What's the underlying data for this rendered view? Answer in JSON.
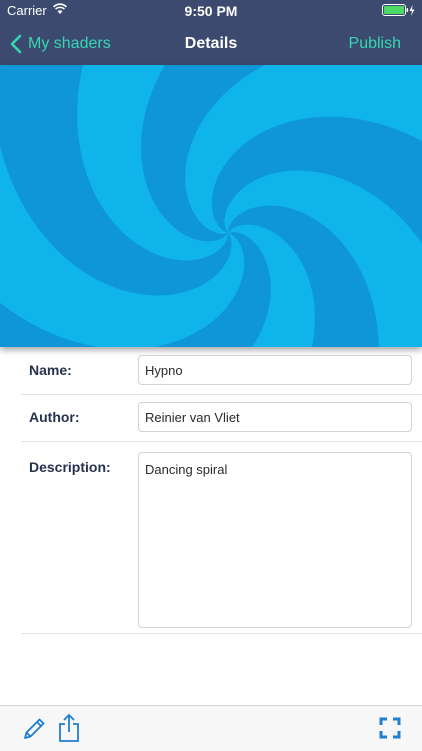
{
  "status_bar": {
    "carrier": "Carrier",
    "time": "9:50 PM"
  },
  "nav": {
    "back_label": "My shaders",
    "title": "Details",
    "action_label": "Publish"
  },
  "form": {
    "name_label": "Name:",
    "name_value": "Hypno",
    "author_label": "Author:",
    "author_value": "Reinier van Vliet",
    "description_label": "Description:",
    "description_value": "Dancing spiral"
  },
  "toolbar": {
    "icons": [
      "edit-icon",
      "share-icon",
      "fullscreen-icon"
    ]
  },
  "colors": {
    "nav_background": "#3b4a6e",
    "accent": "#35d6b3",
    "spiral_light": "#0fb4ea",
    "spiral_dark": "#0e96d8",
    "toolbar_icons": "#1e7fd0"
  }
}
